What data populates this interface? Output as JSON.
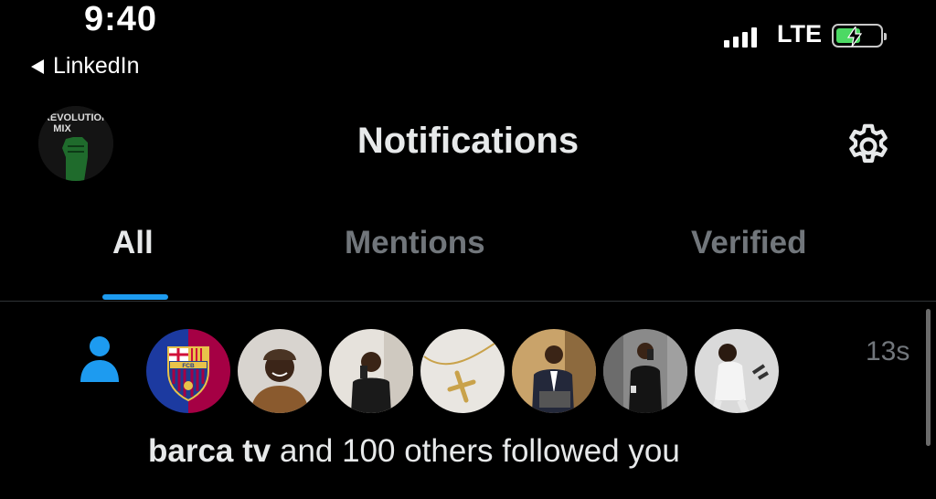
{
  "status_bar": {
    "time": "9:40",
    "back_label": "LinkedIn",
    "network": "LTE",
    "colors": {
      "battery": "#4cd964"
    }
  },
  "header": {
    "title": "Notifications",
    "profile_avatar_text_line1": "REVOLUTION",
    "profile_avatar_text_line2": "MIX",
    "settings_icon": "gear-icon"
  },
  "tabs": [
    {
      "label": "All",
      "active": true
    },
    {
      "label": "Mentions",
      "active": false
    },
    {
      "label": "Verified",
      "active": false
    }
  ],
  "accent": "#1d9bf0",
  "notification": {
    "icon": "person-icon",
    "time": "13s",
    "actor": "barca tv",
    "text": " and 100 others followed you",
    "follower_avatar_count": 7,
    "fcb_badge_text": "FCB"
  }
}
